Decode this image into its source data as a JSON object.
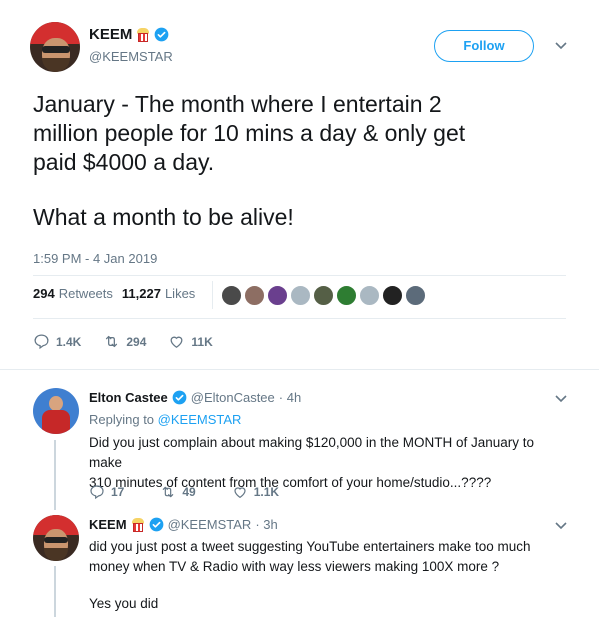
{
  "main_tweet": {
    "author_name": "KEEM",
    "author_handle": "@KEEMSTAR",
    "follow_label": "Follow",
    "text_line1": "January - The month where I entertain 2",
    "text_line2": "million people for 10 mins a day & only get",
    "text_line3": "paid $4000 a day.",
    "text_line4": "What a month to be alive!",
    "timestamp": "1:59 PM - 4 Jan 2019",
    "retweets_count": "294",
    "retweets_label": "Retweets",
    "likes_count": "11,227",
    "likes_label": "Likes",
    "reply_count": "1.4K",
    "retweet_action_count": "294",
    "like_action_count": "11K"
  },
  "reply1": {
    "author_name": "Elton Castee",
    "author_handle": "@EltonCastee",
    "time": "· 4h",
    "replying_prefix": "Replying to",
    "replying_mention": "@KEEMSTAR",
    "text_line1": "Did you just complain about making $120,000 in the MONTH of January to make",
    "text_line2": "310 minutes of content from the comfort of your home/studio...????",
    "reply_count": "17",
    "retweet_count": "49",
    "like_count": "1.1K"
  },
  "reply2": {
    "author_name": "KEEM",
    "author_handle": "@KEEMSTAR",
    "time": "· 3h",
    "text_line1": "did you just post a tweet suggesting YouTube entertainers make too much",
    "text_line2": "money when TV & Radio with way less viewers making 100X more ?",
    "text_line3": "Yes you did"
  },
  "colors": {
    "accent": "#1da1f2",
    "muted": "#657786",
    "text": "#14171a",
    "divider": "#e6ecf0"
  },
  "icons": [
    "popcorn-icon",
    "verified-icon",
    "chevron-down-icon",
    "reply-icon",
    "retweet-icon",
    "heart-icon"
  ]
}
